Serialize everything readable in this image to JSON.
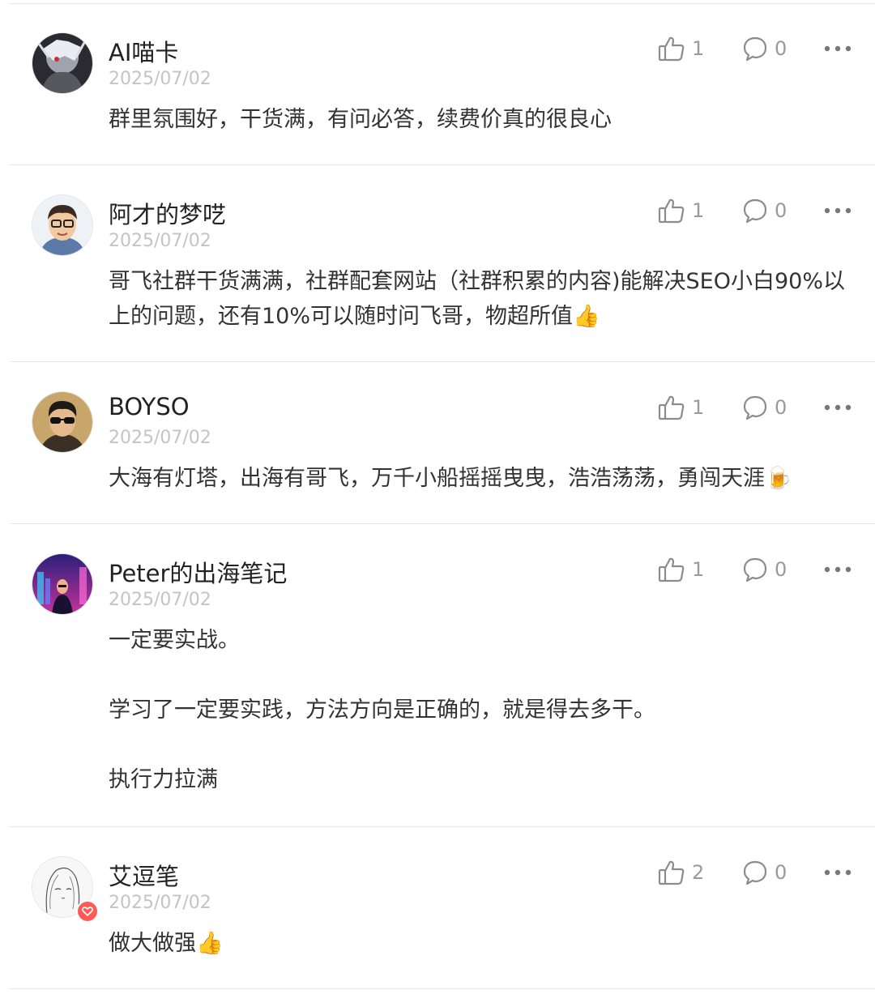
{
  "comments": [
    {
      "author": "AI喵卡",
      "date": "2025/07/02",
      "paragraphs": [
        "群里氛围好，干货满，有问必答，续费价真的很良心"
      ],
      "likes": "1",
      "replies": "0"
    },
    {
      "author": "阿才的梦呓",
      "date": "2025/07/02",
      "paragraphs": [
        "哥飞社群干货满满，社群配套网站（社群积累的内容)能解决SEO小白90%以上的问题，还有10%可以随时问飞哥，物超所值👍"
      ],
      "likes": "1",
      "replies": "0"
    },
    {
      "author": "BOYSO",
      "date": "2025/07/02",
      "paragraphs": [
        "大海有灯塔，出海有哥飞，万千小船摇摇曳曳，浩浩荡荡，勇闯天涯🍺"
      ],
      "likes": "1",
      "replies": "0"
    },
    {
      "author": "Peter的出海笔记",
      "date": "2025/07/02",
      "paragraphs": [
        "一定要实战。",
        "",
        "学习了一定要实践，方法方向是正确的，就是得去多干。",
        "",
        "执行力拉满"
      ],
      "likes": "1",
      "replies": "0"
    },
    {
      "author": "艾逗笔",
      "date": "2025/07/02",
      "paragraphs": [
        "做大做强👍"
      ],
      "likes": "2",
      "replies": "0"
    }
  ],
  "icons": {
    "like": "thumbs-up-icon",
    "reply": "speech-bubble-icon",
    "more": "more-dots-icon",
    "badge": "heart-badge-icon"
  },
  "colors": {
    "divider": "#e8e8e8",
    "date": "#c4c4c4",
    "count": "#9a9a9a",
    "badge": "#ff5a5a"
  }
}
